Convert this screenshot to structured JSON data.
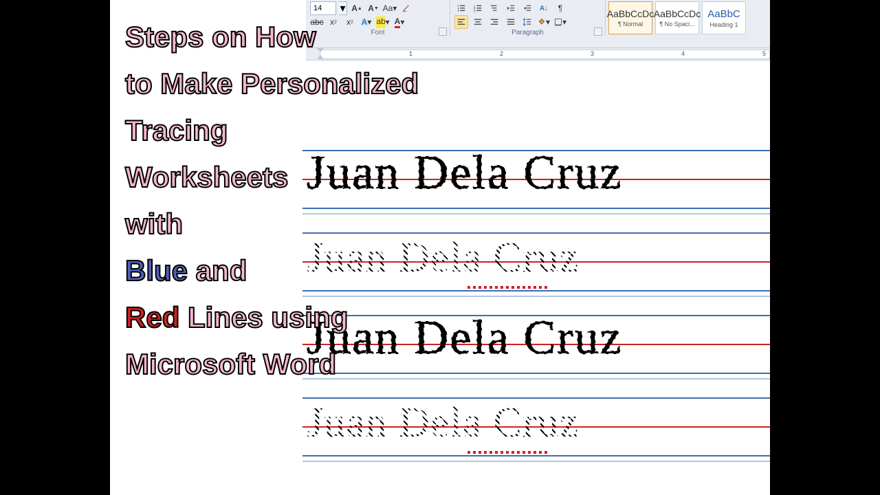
{
  "ribbon": {
    "font_size": "14",
    "font_group_label": "Font",
    "paragraph_group_label": "Paragraph",
    "style_sample": "AaBbCcDc",
    "style_sample_h": "AaBbC",
    "styles": [
      {
        "name": "¶ Normal",
        "selected": true
      },
      {
        "name": "¶ No Spaci..."
      },
      {
        "name": "Heading 1",
        "heading": true
      }
    ]
  },
  "ruler": {
    "marks": [
      "1",
      "2",
      "3",
      "4",
      "5"
    ]
  },
  "title": {
    "l1": "Steps on How",
    "l2": "to Make Personalized",
    "l3": "Tracing",
    "l4": "Worksheets",
    "l5": "with",
    "blue": "Blue",
    "and": " and",
    "red": "Red",
    "l7b": " Lines using",
    "l8": "Microsoft Word"
  },
  "tracing": {
    "name": "Juan Dela Cruz"
  }
}
